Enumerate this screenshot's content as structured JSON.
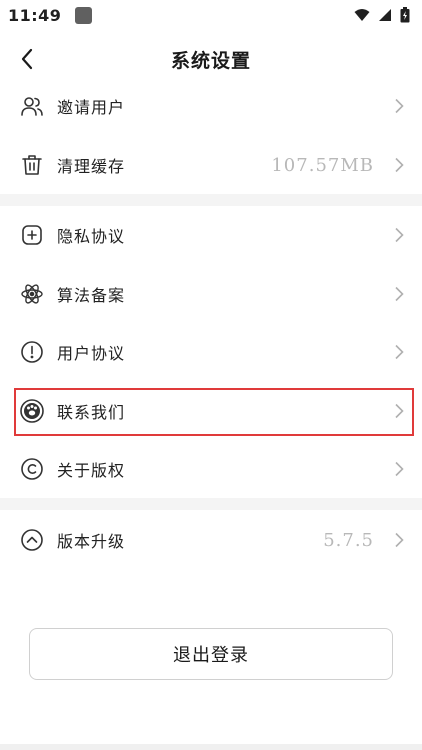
{
  "status_bar": {
    "time": "11:49",
    "icons": [
      "app-notification-icon",
      "wifi-icon",
      "signal-icon",
      "battery-icon"
    ]
  },
  "header": {
    "title": "系统设置",
    "back_icon": "chevron-left-icon"
  },
  "sections": [
    {
      "items": [
        {
          "label": "邀请用户",
          "icon": "users-icon",
          "value": ""
        },
        {
          "label": "清理缓存",
          "icon": "trash-icon",
          "value": "107.57MB"
        }
      ]
    },
    {
      "items": [
        {
          "label": "隐私协议",
          "icon": "plus-square-icon",
          "value": ""
        },
        {
          "label": "算法备案",
          "icon": "atom-icon",
          "value": ""
        },
        {
          "label": "用户协议",
          "icon": "alert-circle-icon",
          "value": ""
        },
        {
          "label": "联系我们",
          "icon": "paw-icon",
          "value": ""
        },
        {
          "label": "关于版权",
          "icon": "copyright-icon",
          "value": ""
        }
      ]
    },
    {
      "items": [
        {
          "label": "版本升级",
          "icon": "chevron-up-circle-icon",
          "value": "5.7.5"
        }
      ]
    }
  ],
  "logout": {
    "label": "退出登录"
  },
  "colors": {
    "highlight_border": "#e03a3a",
    "value_text": "#b8b8b8",
    "section_gap": "#f4f4f4"
  }
}
